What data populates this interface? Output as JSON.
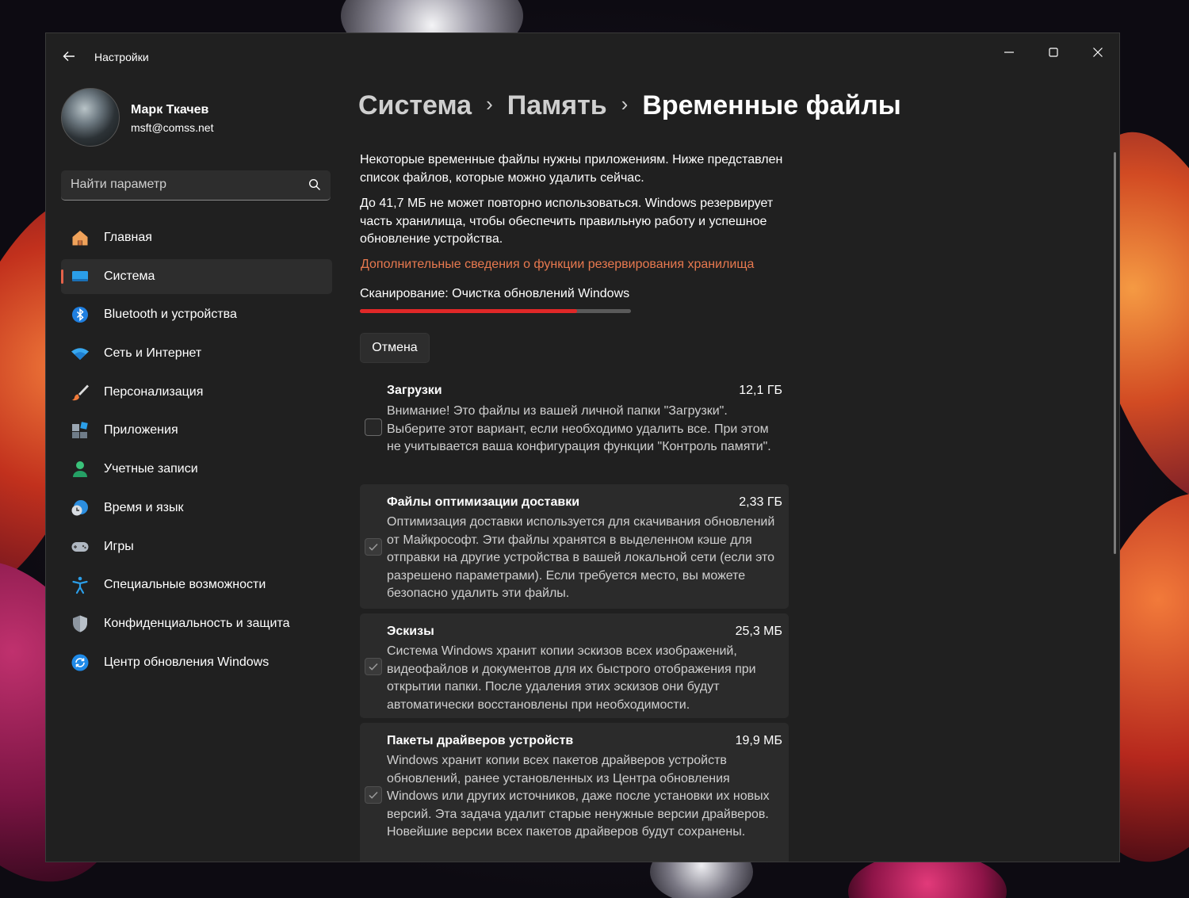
{
  "window": {
    "title": "Настройки"
  },
  "profile": {
    "name": "Марк Ткачев",
    "email": "msft@comss.net"
  },
  "search": {
    "placeholder": "Найти параметр"
  },
  "sidebar": {
    "items": [
      {
        "label": "Главная",
        "icon": "home-icon"
      },
      {
        "label": "Система",
        "icon": "system-icon",
        "active": true
      },
      {
        "label": "Bluetooth и устройства",
        "icon": "bluetooth-icon"
      },
      {
        "label": "Сеть и Интернет",
        "icon": "wifi-icon"
      },
      {
        "label": "Персонализация",
        "icon": "brush-icon"
      },
      {
        "label": "Приложения",
        "icon": "apps-icon"
      },
      {
        "label": "Учетные записи",
        "icon": "account-icon"
      },
      {
        "label": "Время и язык",
        "icon": "time-language-icon"
      },
      {
        "label": "Игры",
        "icon": "gamepad-icon"
      },
      {
        "label": "Специальные возможности",
        "icon": "accessibility-icon"
      },
      {
        "label": "Конфиденциальность и защита",
        "icon": "shield-icon"
      },
      {
        "label": "Центр обновления Windows",
        "icon": "update-icon"
      }
    ]
  },
  "breadcrumb": {
    "level1": "Система",
    "level2": "Память",
    "current": "Временные файлы",
    "separator": "›"
  },
  "main": {
    "intro": "Некоторые временные файлы нужны приложениям. Ниже представлен список файлов, которые можно удалить сейчас.",
    "reserve_info": "До 41,7 МБ не может повторно использоваться. Windows резервирует часть хранилища, чтобы обеспечить правильную работу и успешное обновление устройства.",
    "reserve_link": "Дополнительные сведения о функции резервирования хранилища",
    "scan_status": "Сканирование: Очистка обновлений Windows",
    "scan_progress": 0.8,
    "cancel_label": "Отмена"
  },
  "items": [
    {
      "title": "Загрузки",
      "size": "12,1 ГБ",
      "checked": false,
      "description": "Внимание! Это файлы из вашей личной папки \"Загрузки\". Выберите этот вариант, если необходимо удалить все. При этом не учитывается ваша конфигурация функции \"Контроль памяти\"."
    },
    {
      "title": "Файлы оптимизации доставки",
      "size": "2,33 ГБ",
      "checked": true,
      "description": "Оптимизация доставки используется для скачивания обновлений от Майкрософт. Эти файлы хранятся в выделенном кэше для отправки на другие устройства в вашей локальной сети (если это разрешено параметрами). Если требуется место, вы можете безопасно удалить эти файлы."
    },
    {
      "title": "Эскизы",
      "size": "25,3 МБ",
      "checked": true,
      "description": "Система Windows хранит копии эскизов всех изображений, видеофайлов и документов для их быстрого отображения при открытии папки. После удаления этих эскизов они будут автоматически восстановлены при необходимости."
    },
    {
      "title": "Пакеты драйверов устройств",
      "size": "19,9 МБ",
      "checked": true,
      "description": "Windows хранит копии всех пакетов драйверов устройств обновлений, ранее установленных из Центра обновления Windows или других источников, даже после установки их новых версий. Эта задача удалит старые ненужные версии драйверов. Новейшие версии всех пакетов драйверов будут сохранены."
    }
  ],
  "colors": {
    "accent": "#e5624a",
    "progress": "#e02828",
    "link": "#e8794f",
    "window_bg": "#202020"
  }
}
